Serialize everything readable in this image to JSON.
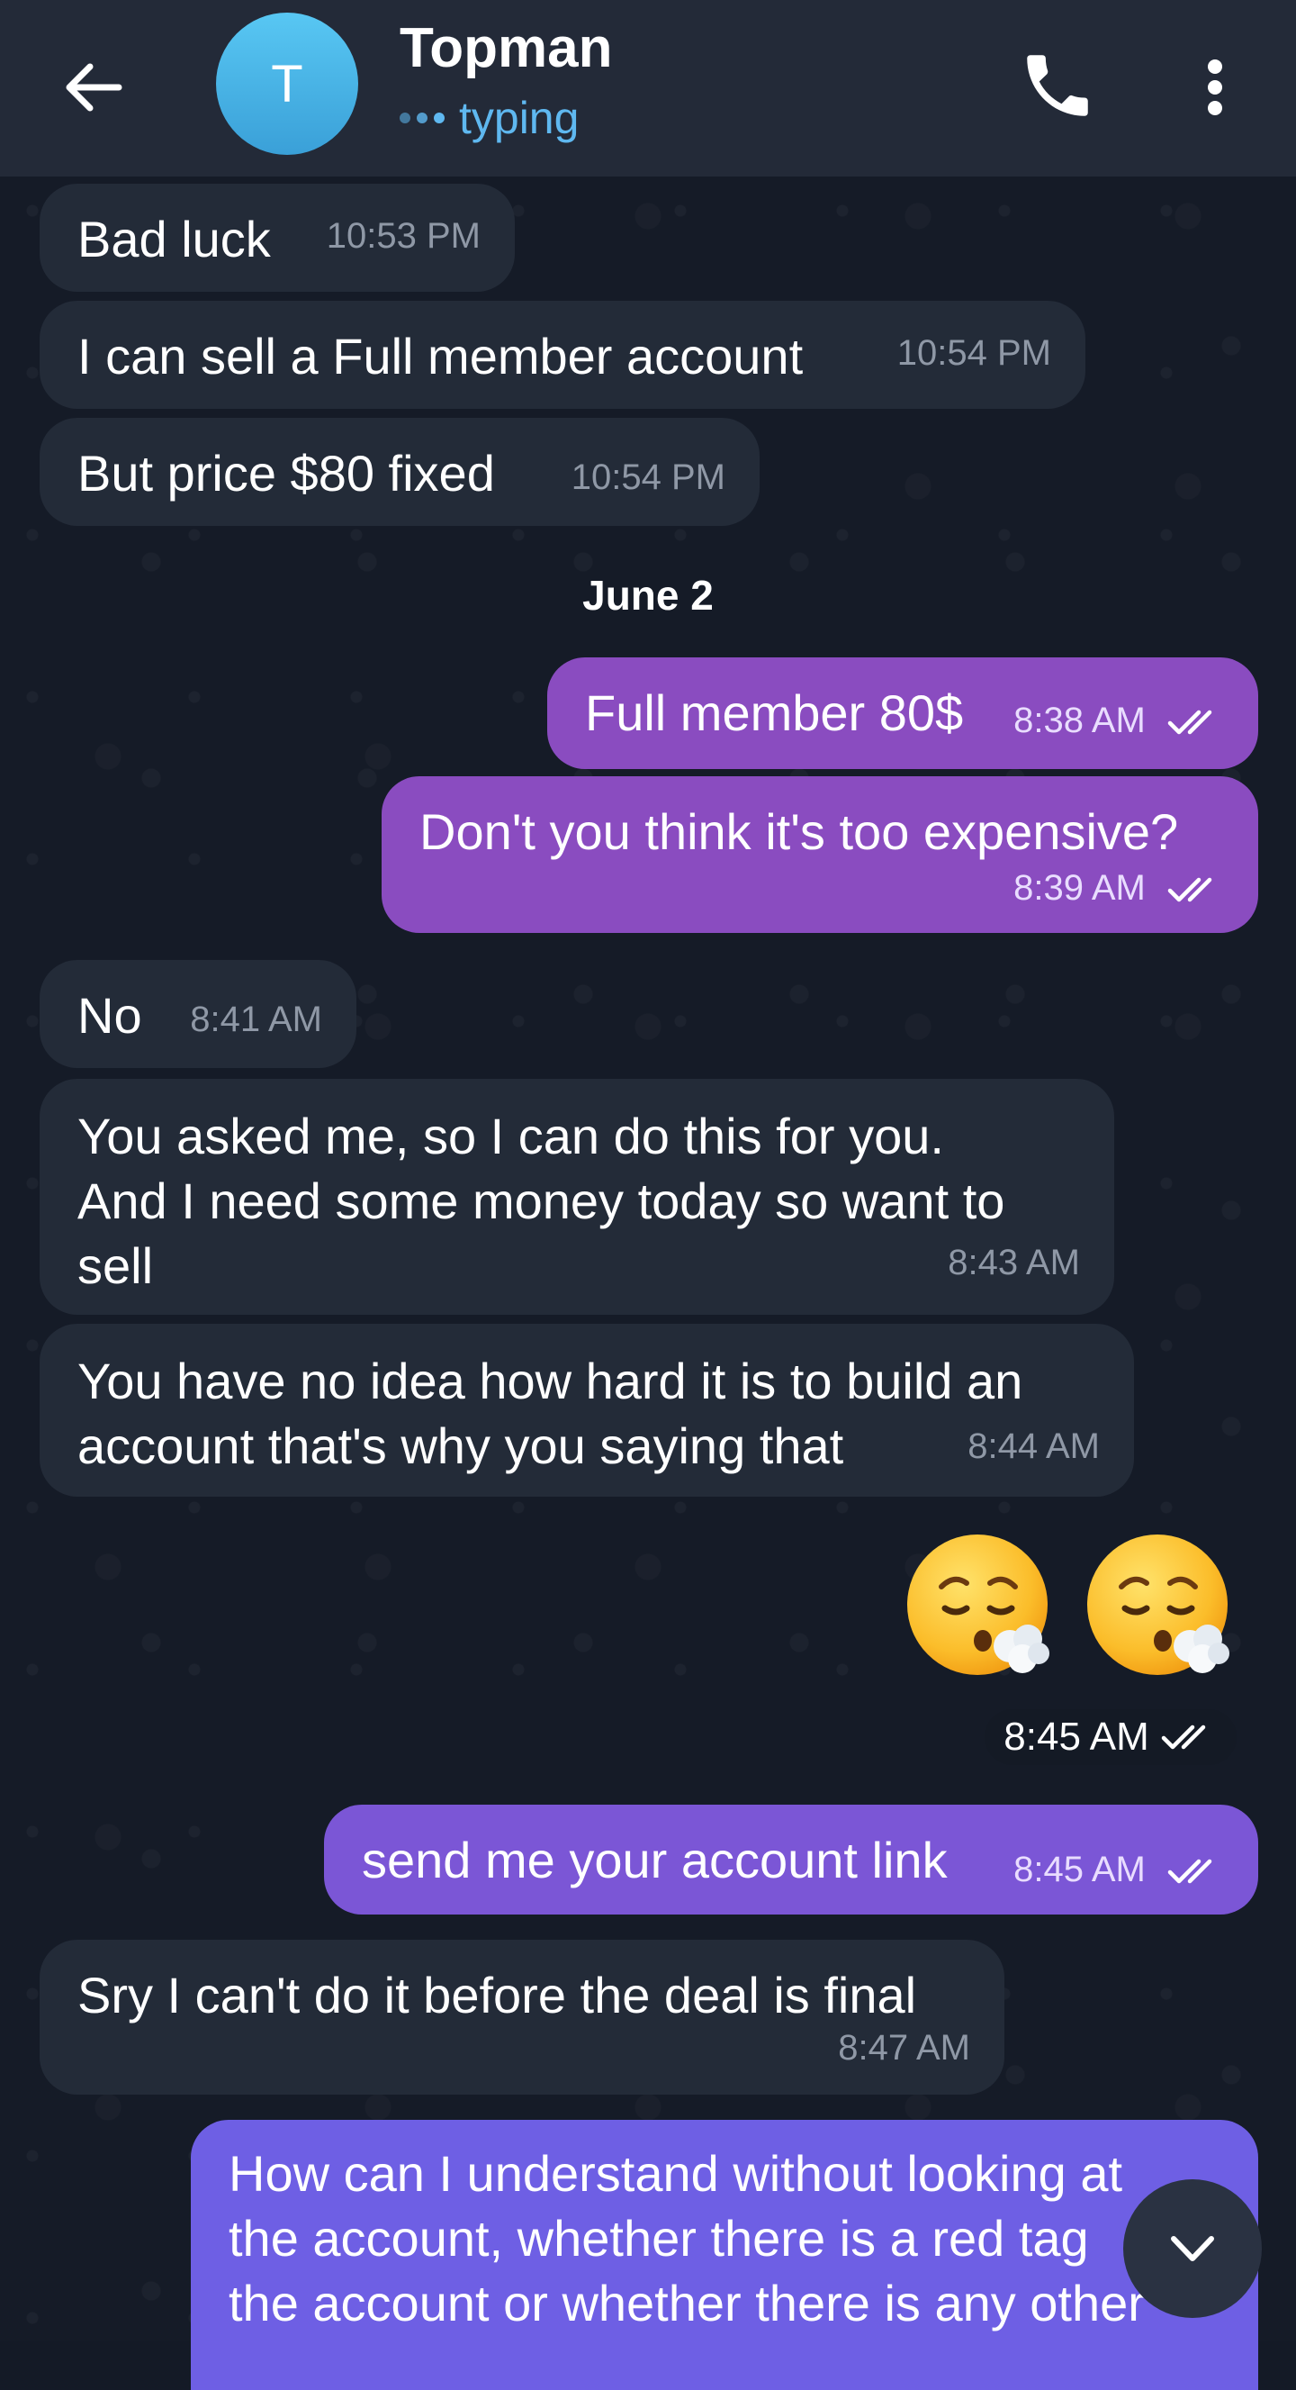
{
  "header": {
    "contact_name": "Topman",
    "avatar_letter": "T",
    "status": "typing"
  },
  "date_separator": "June 2",
  "messages": [
    {
      "dir": "in",
      "text": "Bad luck",
      "time": "10:53 PM"
    },
    {
      "dir": "in",
      "text": "I can sell a Full member account",
      "time": "10:54 PM"
    },
    {
      "dir": "in",
      "text": "But price $80 fixed",
      "time": "10:54 PM"
    },
    {
      "dir": "out",
      "text": "Full member 80$",
      "time": "8:38 AM"
    },
    {
      "dir": "out",
      "text": "Don't you think it's too expensive?",
      "time": "8:39 AM"
    },
    {
      "dir": "in",
      "text": "No",
      "time": "8:41 AM"
    },
    {
      "dir": "in",
      "text": "You asked me, so I can do this for you.\nAnd I need some money today so want to\nsell",
      "time": "8:43 AM"
    },
    {
      "dir": "in",
      "text": "You have no idea how hard it is to build an\naccount that's why you saying that",
      "time": "8:44 AM"
    },
    {
      "dir": "out",
      "type": "emoji",
      "emoji": [
        "face-exhaling-emoji",
        "face-exhaling-emoji"
      ],
      "time": "8:45 AM"
    },
    {
      "dir": "out",
      "text": "send me your account link",
      "time": "8:45 AM"
    },
    {
      "dir": "in",
      "text": "Sry I can't do it before the deal is final",
      "time": "8:47 AM"
    },
    {
      "dir": "out",
      "text": "How can I understand without looking at\nthe account, whether there is a red tag\nthe account or whether there is any other",
      "time": ""
    }
  ],
  "colors": {
    "header_bg": "#232a38",
    "incoming_bubble": "#232b38",
    "outgoing_bubble": "#8a4cc0",
    "outgoing_bubble_late": "#6e5fe4",
    "status_blue": "#5fb8f0",
    "avatar": "#3aa0d8"
  },
  "icons": {
    "back": "arrow-left-icon",
    "call": "phone-icon",
    "menu": "more-vertical-icon",
    "read": "double-check-icon",
    "scroll": "chevron-down-icon"
  }
}
